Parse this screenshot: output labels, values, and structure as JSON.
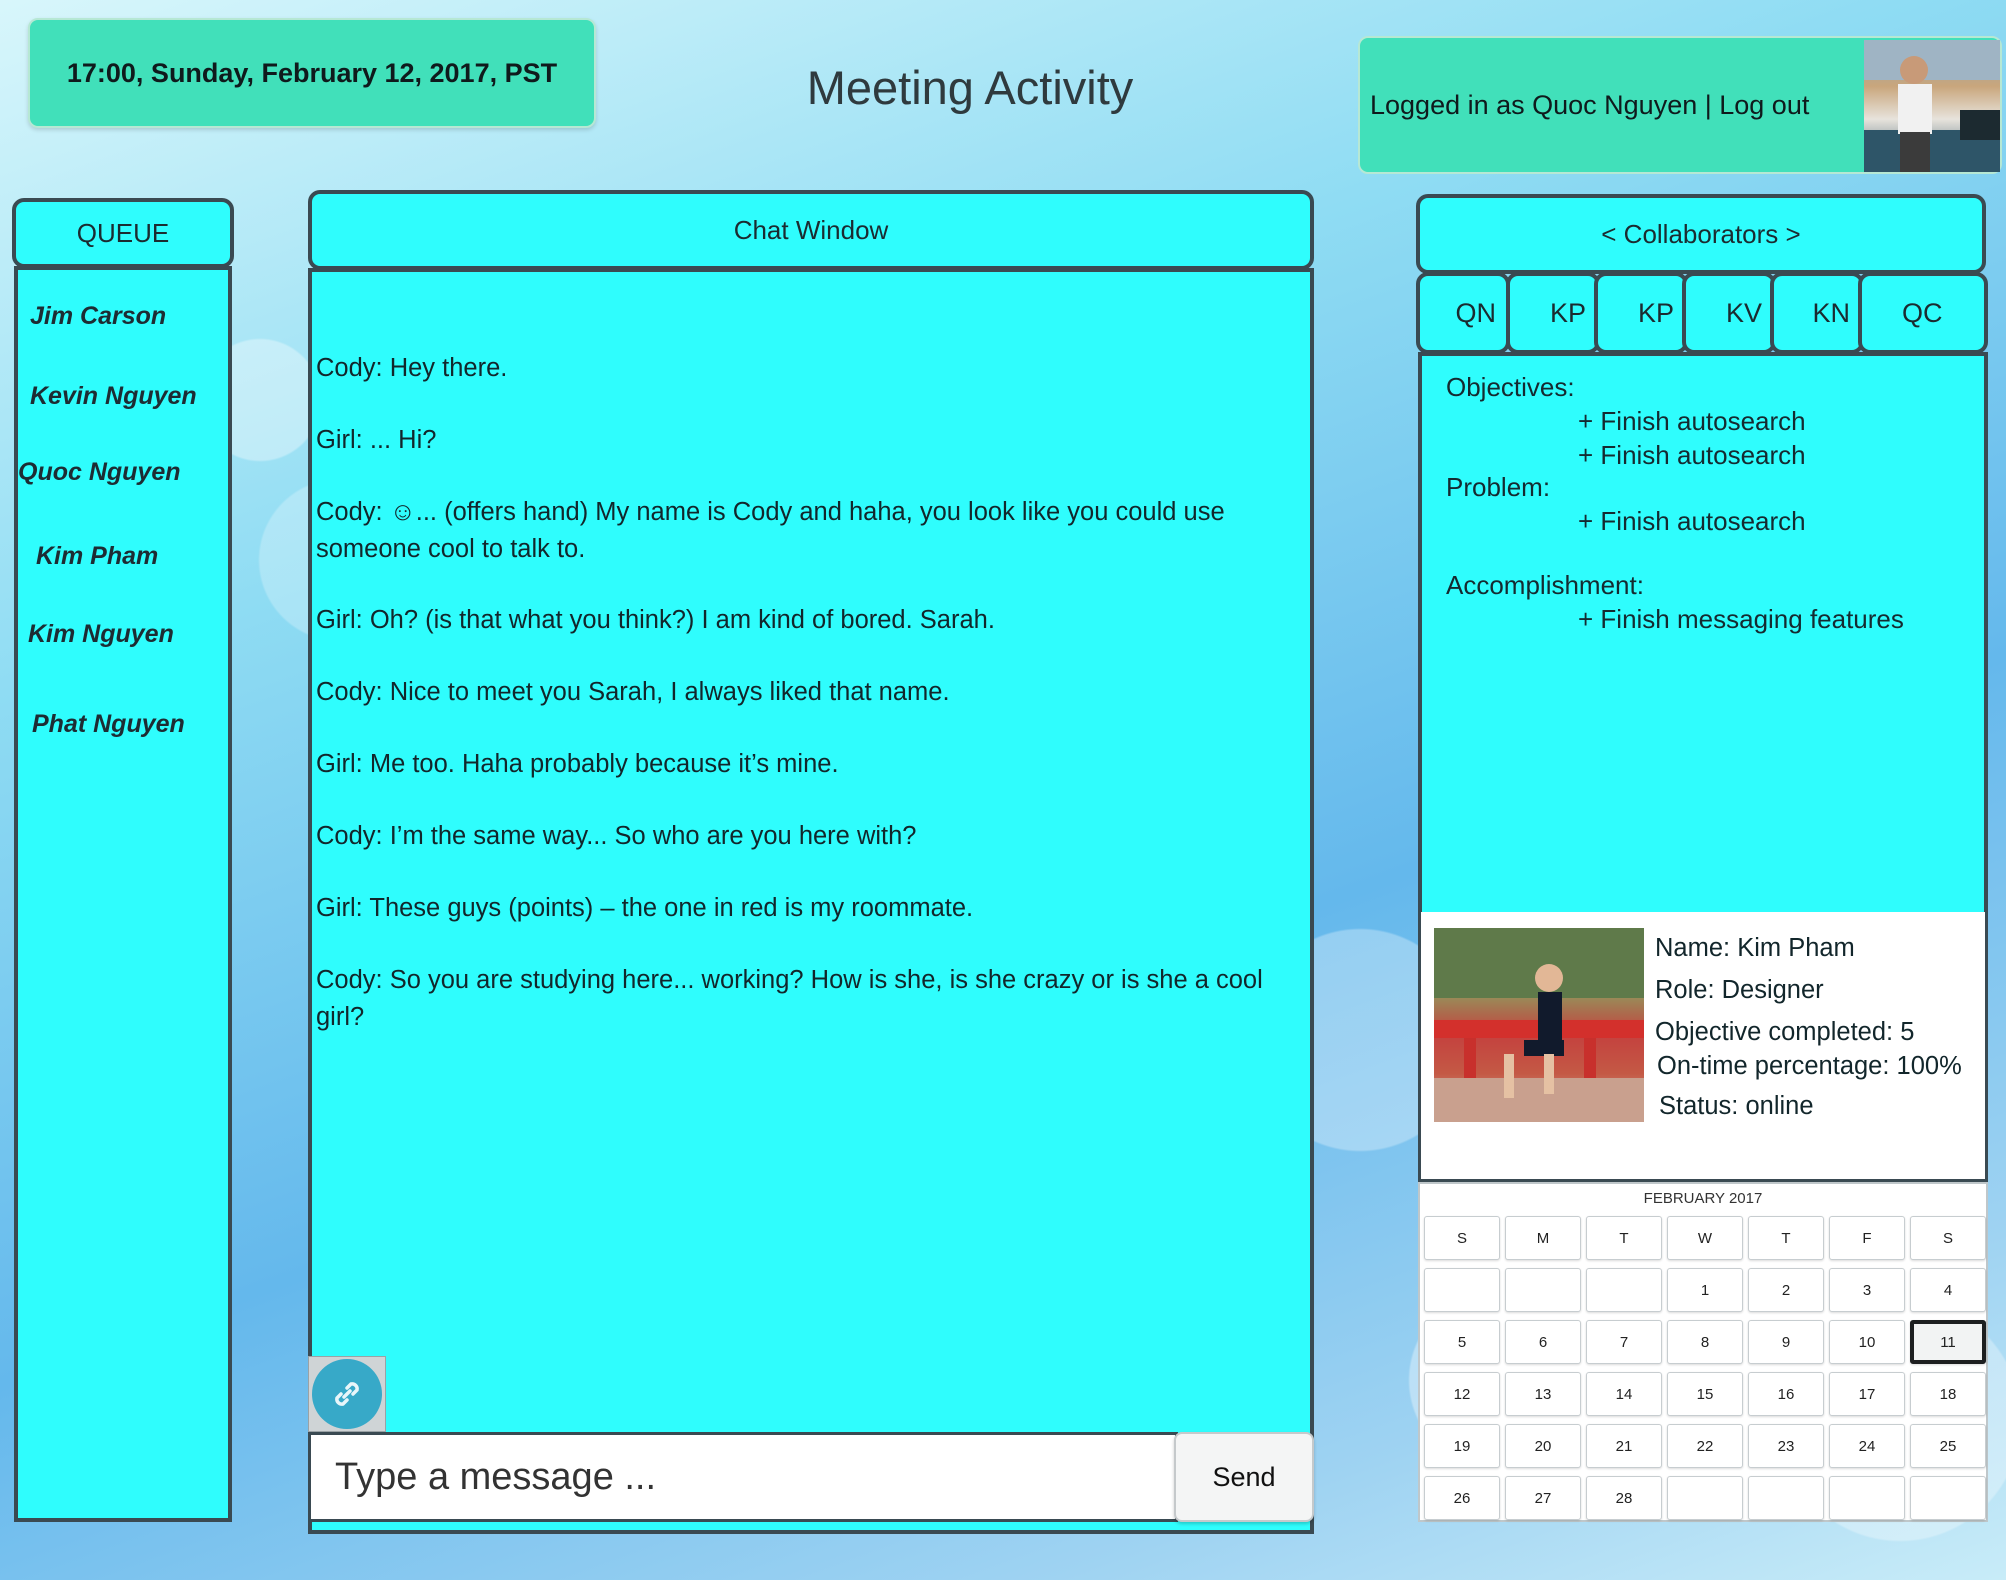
{
  "datetime": "17:00, Sunday, February 12, 2017, PST",
  "title": "Meeting Activity",
  "login": {
    "text": "Logged in as Quoc Nguyen | Log out"
  },
  "queue": {
    "title": "QUEUE",
    "names": [
      "Jim Carson",
      "Kevin Nguyen",
      "Quoc Nguyen",
      "Kim Pham",
      "Kim Nguyen",
      "Phat Nguyen"
    ]
  },
  "chat": {
    "title": "Chat Window",
    "messages": [
      "Cody: Hey there.",
      "Girl: ... Hi?",
      "Cody: ☺... (offers hand) My name is Cody and haha, you look like you could use someone cool to talk to.",
      "Girl: Oh? (is that what you think?) I am kind of bored. Sarah.",
      "Cody: Nice to meet you Sarah, I always liked that name.",
      "Girl: Me too. Haha probably because it’s mine.",
      "Cody: I’m the same way... So who are you here with?",
      "Girl: These guys (points) – the one in red is my roommate.",
      "Cody: So you are studying here... working? How is she, is she crazy or is she a cool girl?"
    ],
    "input_placeholder": "Type a message ...",
    "send_label": "Send",
    "link_icon": "link-icon"
  },
  "collaborators": {
    "title": "< Collaborators >",
    "tabs": [
      "QN",
      "KP",
      "KP",
      "KV",
      "KN",
      "QC"
    ],
    "objectives_label": "Objectives:",
    "objectives": [
      "+ Finish autosearch",
      "+ Finish autosearch"
    ],
    "problem_label": "Problem:",
    "problems": [
      "+ Finish autosearch"
    ],
    "accomplishment_label": "Accomplishment:",
    "accomplishments": [
      "+ Finish messaging features"
    ]
  },
  "profile": {
    "name": "Name: Kim Pham",
    "role": "Role: Designer",
    "objective_completed": "Objective completed: 5",
    "on_time": "On-time percentage: 100%",
    "status": "Status: online"
  },
  "calendar": {
    "title": "FEBRUARY 2017",
    "weekdays": [
      "S",
      "M",
      "T",
      "W",
      "T",
      "F",
      "S"
    ],
    "weeks": [
      [
        "",
        "",
        "",
        "1",
        "2",
        "3",
        "4"
      ],
      [
        "5",
        "6",
        "7",
        "8",
        "9",
        "10",
        "11"
      ],
      [
        "12",
        "13",
        "14",
        "15",
        "16",
        "17",
        "18"
      ],
      [
        "19",
        "20",
        "21",
        "22",
        "23",
        "24",
        "25"
      ],
      [
        "26",
        "27",
        "28",
        "",
        "",
        "",
        ""
      ]
    ],
    "selected_day": "11"
  },
  "colors": {
    "panel": "#2ffdfd",
    "header_green": "#41e0ba",
    "border": "#3a4a52"
  }
}
